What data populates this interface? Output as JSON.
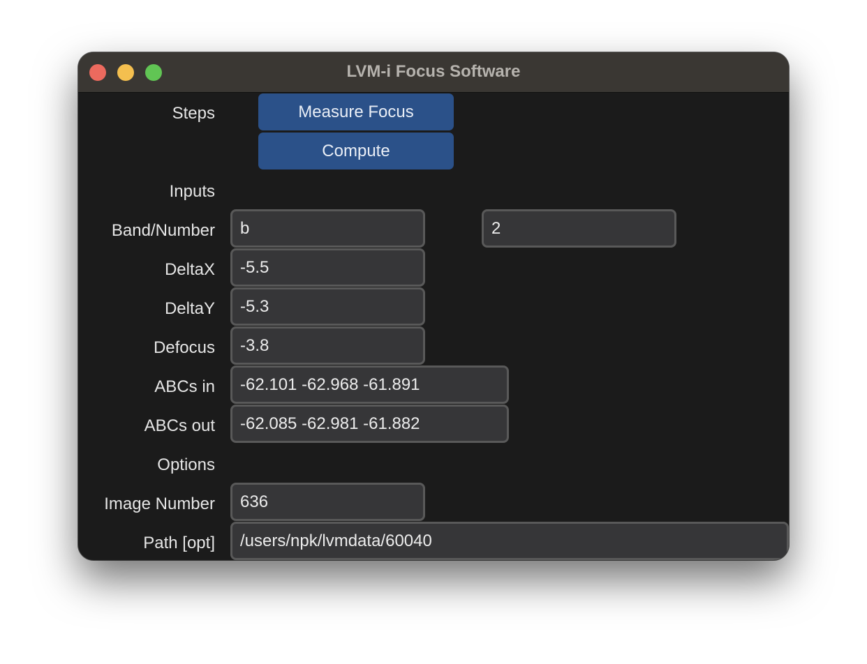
{
  "window": {
    "title": "LVM-i Focus Software"
  },
  "steps": {
    "label": "Steps",
    "measure_focus_label": "Measure Focus",
    "compute_label": "Compute"
  },
  "inputs": {
    "section_label": "Inputs",
    "band_number_label": "Band/Number",
    "band_value": "b",
    "number_value": "2",
    "deltax_label": "DeltaX",
    "deltax_value": "-5.5",
    "deltay_label": "DeltaY",
    "deltay_value": "-5.3",
    "defocus_label": "Defocus",
    "defocus_value": "-3.8",
    "abcs_in_label": "ABCs in",
    "abcs_in_value": "-62.101 -62.968 -61.891",
    "abcs_out_label": "ABCs out",
    "abcs_out_value": "-62.085 -62.981 -61.882"
  },
  "options": {
    "section_label": "Options",
    "image_number_label": "Image Number",
    "image_number_value": "636",
    "path_label": "Path [opt]",
    "path_value": "/users/npk/lvmdata/60040"
  },
  "colors": {
    "window_background": "#1b1b1b",
    "titlebar": "#3a3733",
    "button": "#2b5189",
    "field_background": "#363638",
    "field_border": "#595959",
    "close": "#ec6a5e",
    "minimize": "#f4bf4f",
    "zoom": "#61c554"
  }
}
